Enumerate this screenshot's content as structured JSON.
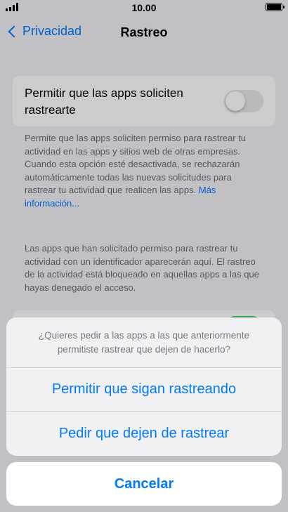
{
  "status_bar": {
    "time": "10.00"
  },
  "nav": {
    "back_label": "Privacidad",
    "title": "Rastreo"
  },
  "setting": {
    "toggle_label": "Permitir que las apps soliciten rastrearte",
    "toggle_state": "off",
    "description": "Permite que las apps soliciten permiso para rastrear tu actividad en las apps y sitios web de otras empresas. Cuando esta opción esté desactivada, se rechazarán automáticamente todas las nuevas solicitudes para rastrear tu actividad que realicen las apps.",
    "more_link": "Más información...",
    "apps_note": "Las apps que han solicitado permiso para rastrear tu actividad con un identificador aparecerán aquí. El rastreo de la actividad está bloqueado en aquellas apps a las que hayas denegado el acceso."
  },
  "action_sheet": {
    "message": "¿Quieres pedir a las apps a las que anteriormente permitiste rastrear que dejen de hacerlo?",
    "allow_label": "Permitir que sigan rastreando",
    "ask_stop_label": "Pedir que dejen de rastrear",
    "cancel_label": "Cancelar"
  },
  "colors": {
    "accent": "#007aff",
    "toggle_on": "#34c759"
  }
}
